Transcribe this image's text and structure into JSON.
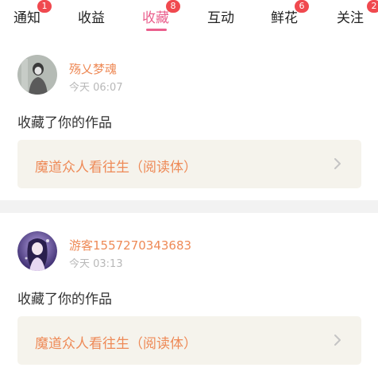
{
  "tabs": [
    {
      "label": "通知",
      "badge": "1"
    },
    {
      "label": "收益",
      "badge": ""
    },
    {
      "label": "收藏",
      "badge": "8"
    },
    {
      "label": "互动",
      "badge": ""
    },
    {
      "label": "鲜花",
      "badge": "6"
    },
    {
      "label": "关注",
      "badge": "2"
    }
  ],
  "active_tab": "收藏",
  "accent_color": "#ea5f8d",
  "items": [
    {
      "username": "殇乂梦魂",
      "time": "今天 06:07",
      "action": "收藏了你的作品",
      "work_title": "魔道众人看往生（阅读体）",
      "avatar_icon": "user-avatar-grayscale-girl"
    },
    {
      "username": "游客1557270343683",
      "time": "今天 03:13",
      "action": "收藏了你的作品",
      "work_title": "魔道众人看往生（阅读体）",
      "avatar_icon": "user-avatar-purple-anime"
    }
  ]
}
